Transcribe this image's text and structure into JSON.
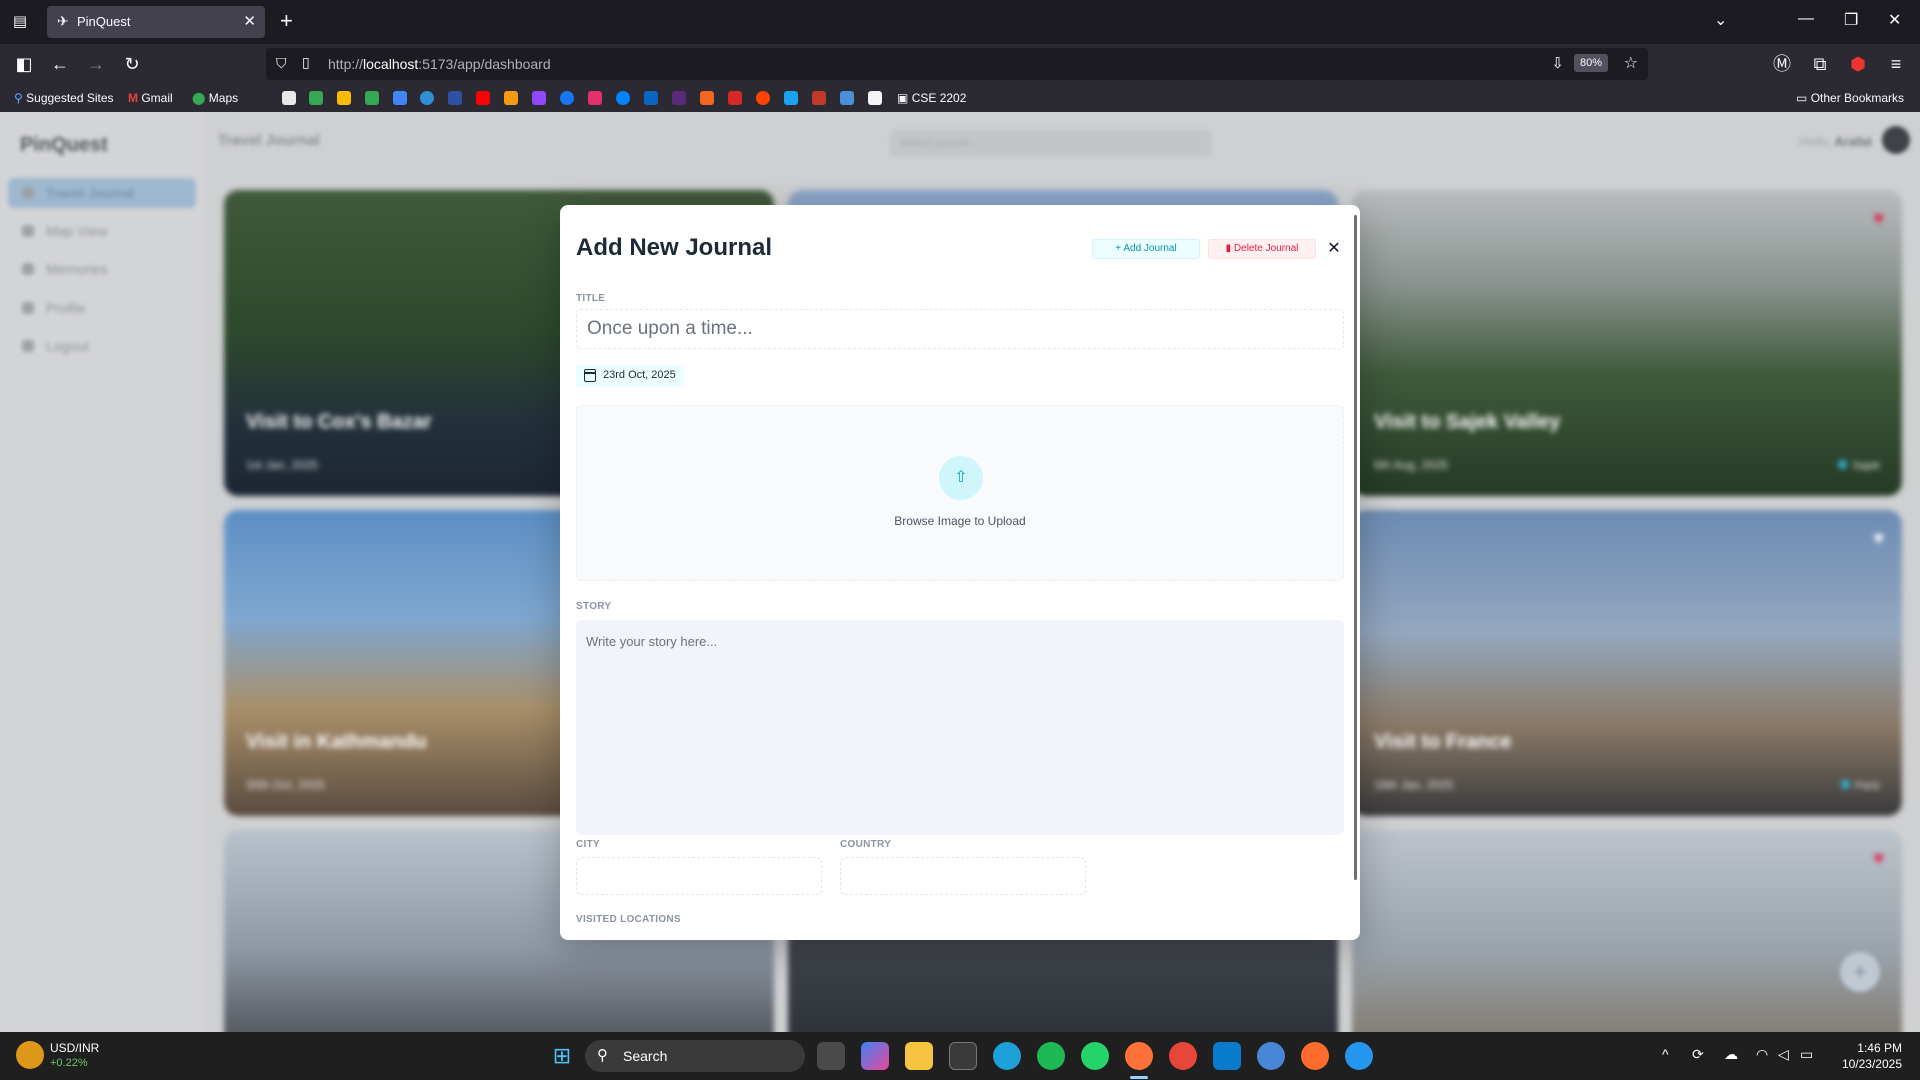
{
  "browser": {
    "tab_title": "PinQuest",
    "url_prefix": "http://",
    "url_host": "localhost",
    "url_rest": ":5173/app/dashboard",
    "zoom": "80%",
    "bookmarks": [
      "Suggested Sites",
      "Gmail",
      "Maps",
      "CSE 2202"
    ],
    "other_bookmarks": "Other Bookmarks"
  },
  "app": {
    "brand": "PinQuest",
    "page_title": "Travel Journal",
    "search_placeholder": "search journal...",
    "greeting": "Hello,",
    "user_name": "Arafat",
    "nav": [
      {
        "label": "Travel Journal",
        "active": true
      },
      {
        "label": "Map View"
      },
      {
        "label": "Memories"
      },
      {
        "label": "Profile"
      },
      {
        "label": "Logout"
      }
    ],
    "cards": [
      {
        "title": "Visit to Cox's Bazar",
        "date": "1st Jan, 2025"
      },
      {
        "title": "Visit to Sajek Valley",
        "date": "6th Aug, 2025",
        "location": "Sajek"
      },
      {
        "title": "Visit in Kathmandu",
        "date": "30th Oct, 2025"
      },
      {
        "title": "Visit to France",
        "date": "18th Jan, 2025",
        "location": "Paris"
      }
    ]
  },
  "modal": {
    "title": "Add New Journal",
    "add_button": "Add Journal",
    "delete_button": "Delete Journal",
    "labels": {
      "title": "TITLE",
      "story": "STORY",
      "city": "CITY",
      "country": "COUNTRY",
      "visited": "VISITED LOCATIONS"
    },
    "title_placeholder": "Once upon a time...",
    "date": "23rd Oct, 2025",
    "upload_text": "Browse Image to Upload",
    "story_placeholder": "Write your story here...",
    "city_value": "",
    "country_value": ""
  },
  "taskbar": {
    "ticker_name": "USD/INR",
    "ticker_change": "+0.22%",
    "search_label": "Search",
    "time": "1:46 PM",
    "date": "10/23/2025"
  },
  "colors": {
    "accent": "#0891b2",
    "danger": "#e11d48",
    "heart": "#e11d48"
  }
}
